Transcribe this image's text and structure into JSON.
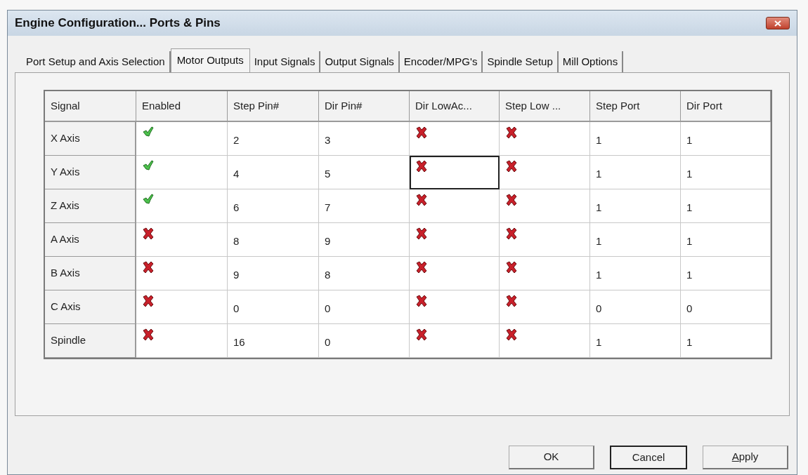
{
  "window": {
    "title": "Engine Configuration... Ports & Pins"
  },
  "tabs": [
    {
      "label": "Port Setup and Axis Selection",
      "selected": false
    },
    {
      "label": "Motor Outputs",
      "selected": true
    },
    {
      "label": "Input Signals",
      "selected": false
    },
    {
      "label": "Output Signals",
      "selected": false
    },
    {
      "label": "Encoder/MPG's",
      "selected": false
    },
    {
      "label": "Spindle Setup",
      "selected": false
    },
    {
      "label": "Mill Options",
      "selected": false
    }
  ],
  "table": {
    "columns": [
      {
        "label": "Signal",
        "kind": "header"
      },
      {
        "label": "Enabled",
        "kind": "bool"
      },
      {
        "label": "Step Pin#",
        "kind": "text"
      },
      {
        "label": "Dir Pin#",
        "kind": "text"
      },
      {
        "label": "Dir LowAc...",
        "kind": "bool"
      },
      {
        "label": "Step Low ...",
        "kind": "bool"
      },
      {
        "label": "Step Port",
        "kind": "text"
      },
      {
        "label": "Dir Port",
        "kind": "text"
      }
    ],
    "rows": [
      {
        "cells": [
          "X Axis",
          true,
          "2",
          "3",
          false,
          false,
          "1",
          "1"
        ],
        "focused": false
      },
      {
        "cells": [
          "Y Axis",
          true,
          "4",
          "5",
          false,
          false,
          "1",
          "1"
        ],
        "focused": true
      },
      {
        "cells": [
          "Z Axis",
          true,
          "6",
          "7",
          false,
          false,
          "1",
          "1"
        ],
        "focused": false
      },
      {
        "cells": [
          "A Axis",
          false,
          "8",
          "9",
          false,
          false,
          "1",
          "1"
        ],
        "focused": false
      },
      {
        "cells": [
          "B Axis",
          false,
          "9",
          "8",
          false,
          false,
          "1",
          "1"
        ],
        "focused": false
      },
      {
        "cells": [
          "C Axis",
          false,
          "0",
          "0",
          false,
          false,
          "0",
          "0"
        ],
        "focused": false
      },
      {
        "cells": [
          "Spindle",
          false,
          "16",
          "0",
          false,
          false,
          "1",
          "1"
        ],
        "focused": false
      }
    ]
  },
  "buttons": [
    {
      "label": "OK",
      "default": false,
      "mnemonic": false
    },
    {
      "label": "Cancel",
      "default": true,
      "mnemonic": false
    },
    {
      "label": "Apply",
      "default": false,
      "mnemonic": true
    }
  ]
}
